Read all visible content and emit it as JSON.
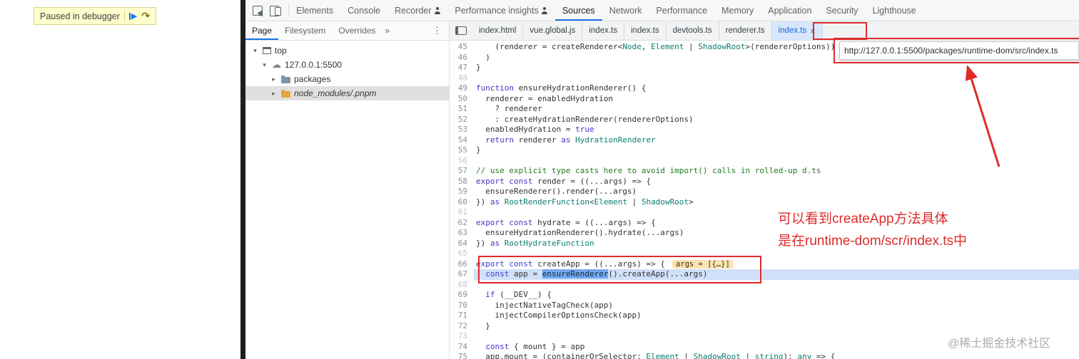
{
  "page": {
    "paused_banner": {
      "label": "Paused in debugger"
    }
  },
  "icon_glyphs": {
    "expanded": "▾",
    "collapsed": "▸",
    "cloud": "☁",
    "more": "⋮",
    "overflow": "»",
    "close": "×",
    "resume": "▶",
    "step_over": "↷"
  },
  "colors": {
    "accent": "#1a73e8",
    "annotation_red": "#e02b2b",
    "keyword": "#4135c4",
    "type": "#0b7f6e",
    "comment": "#237a23",
    "paused_line_bg": "#cfe0f8",
    "selection_bg": "#74a9ef",
    "inline_eval_bg": "#fbe3b3",
    "selected_row_bg": "#e0e0e0",
    "active_file_tab_bg": "#d7e7fe"
  },
  "devtools": {
    "toolbar": {
      "tabs": [
        {
          "label": "Elements"
        },
        {
          "label": "Console"
        },
        {
          "label": "Recorder",
          "badge": true
        },
        {
          "label": "Performance insights",
          "badge": true
        },
        {
          "label": "Sources",
          "active": true
        },
        {
          "label": "Network"
        },
        {
          "label": "Performance"
        },
        {
          "label": "Memory"
        },
        {
          "label": "Application"
        },
        {
          "label": "Security"
        },
        {
          "label": "Lighthouse"
        }
      ]
    },
    "sidebar": {
      "tabs": [
        {
          "label": "Page",
          "active": true
        },
        {
          "label": "Filesystem"
        },
        {
          "label": "Overrides"
        }
      ],
      "overflow_chevron": "»",
      "more_icon": "⋮",
      "tree": [
        {
          "label": "top",
          "icon": "frame",
          "depth": 0,
          "expanded": true
        },
        {
          "label": "127.0.0.1:5500",
          "icon": "cloud",
          "depth": 1,
          "expanded": true
        },
        {
          "label": "packages",
          "icon": "folder-blue",
          "depth": 2,
          "expanded": false
        },
        {
          "label": "node_modules/.pnpm",
          "icon": "folder-orange",
          "depth": 2,
          "expanded": false,
          "selected": true,
          "italic": true
        }
      ]
    },
    "editor": {
      "tabs": [
        {
          "label": "index.html"
        },
        {
          "label": "vue.global.js"
        },
        {
          "label": "index.ts"
        },
        {
          "label": "index.ts"
        },
        {
          "label": "devtools.ts"
        },
        {
          "label": "renderer.ts"
        },
        {
          "label": "index.ts",
          "active": true
        }
      ],
      "tab_tooltip_url": "http://127.0.0.1:5500/packages/runtime-dom/src/index.ts",
      "paused_line": 67,
      "lines": [
        {
          "n": 45,
          "tokens": [
            [
              "p",
              "    (renderer = createRenderer<"
            ],
            [
              "t",
              "Node"
            ],
            [
              "p",
              ", "
            ],
            [
              "t",
              "Element"
            ],
            [
              "p",
              " | "
            ],
            [
              "t",
              "ShadowRoot"
            ],
            [
              "p",
              ">(rendererOptions))"
            ]
          ]
        },
        {
          "n": 46,
          "tokens": [
            [
              "p",
              "  )"
            ]
          ]
        },
        {
          "n": 47,
          "tokens": [
            [
              "p",
              "}"
            ]
          ]
        },
        {
          "n": 48,
          "tokens": [],
          "dim": true
        },
        {
          "n": 49,
          "tokens": [
            [
              "k",
              "function"
            ],
            [
              "p",
              " ensureHydrationRenderer() {"
            ]
          ]
        },
        {
          "n": 50,
          "tokens": [
            [
              "p",
              "  renderer = enabledHydration"
            ]
          ]
        },
        {
          "n": 51,
          "tokens": [
            [
              "p",
              "    ? renderer"
            ]
          ]
        },
        {
          "n": 52,
          "tokens": [
            [
              "p",
              "    : createHydrationRenderer(rendererOptions)"
            ]
          ]
        },
        {
          "n": 53,
          "tokens": [
            [
              "p",
              "  enabledHydration = "
            ],
            [
              "k",
              "true"
            ]
          ]
        },
        {
          "n": 54,
          "tokens": [
            [
              "p",
              "  "
            ],
            [
              "k",
              "return"
            ],
            [
              "p",
              " renderer "
            ],
            [
              "k",
              "as"
            ],
            [
              "p",
              " "
            ],
            [
              "t",
              "HydrationRenderer"
            ]
          ]
        },
        {
          "n": 55,
          "tokens": [
            [
              "p",
              "}"
            ]
          ]
        },
        {
          "n": 56,
          "tokens": [],
          "dim": true
        },
        {
          "n": 57,
          "tokens": [
            [
              "c",
              "// use explicit type casts here to avoid import() calls in rolled-up d.ts"
            ]
          ]
        },
        {
          "n": 58,
          "tokens": [
            [
              "k",
              "export"
            ],
            [
              "p",
              " "
            ],
            [
              "k",
              "const"
            ],
            [
              "p",
              " render = ((...args) => {"
            ]
          ]
        },
        {
          "n": 59,
          "tokens": [
            [
              "p",
              "  ensureRenderer().render(...args)"
            ]
          ]
        },
        {
          "n": 60,
          "tokens": [
            [
              "p",
              "}) "
            ],
            [
              "k",
              "as"
            ],
            [
              "p",
              " "
            ],
            [
              "t",
              "RootRenderFunction"
            ],
            [
              "p",
              "<"
            ],
            [
              "t",
              "Element"
            ],
            [
              "p",
              " | "
            ],
            [
              "t",
              "ShadowRoot"
            ],
            [
              "p",
              ">"
            ]
          ]
        },
        {
          "n": 61,
          "tokens": [],
          "dim": true
        },
        {
          "n": 62,
          "tokens": [
            [
              "k",
              "export"
            ],
            [
              "p",
              " "
            ],
            [
              "k",
              "const"
            ],
            [
              "p",
              " hydrate = ((...args) => {"
            ]
          ]
        },
        {
          "n": 63,
          "tokens": [
            [
              "p",
              "  ensureHydrationRenderer().hydrate(...args)"
            ]
          ]
        },
        {
          "n": 64,
          "tokens": [
            [
              "p",
              "}) "
            ],
            [
              "k",
              "as"
            ],
            [
              "p",
              " "
            ],
            [
              "t",
              "RootHydrateFunction"
            ]
          ]
        },
        {
          "n": 65,
          "tokens": [],
          "dim": true
        },
        {
          "n": 66,
          "tokens": [
            [
              "k",
              "export"
            ],
            [
              "p",
              " "
            ],
            [
              "k",
              "const"
            ],
            [
              "p",
              " createApp = ((...args) => {"
            ]
          ],
          "badge": "args = [{…}]"
        },
        {
          "n": 67,
          "tokens": [
            [
              "p",
              "  "
            ],
            [
              "k",
              "const"
            ],
            [
              "p",
              " app = "
            ],
            [
              "s",
              "ensureRenderer"
            ],
            [
              "p",
              "().createApp(...args)"
            ]
          ],
          "paused": true
        },
        {
          "n": 68,
          "tokens": [],
          "dim": true
        },
        {
          "n": 69,
          "tokens": [
            [
              "p",
              "  "
            ],
            [
              "k",
              "if"
            ],
            [
              "p",
              " (__DEV__) {"
            ]
          ]
        },
        {
          "n": 70,
          "tokens": [
            [
              "p",
              "    injectNativeTagCheck(app)"
            ]
          ]
        },
        {
          "n": 71,
          "tokens": [
            [
              "p",
              "    injectCompilerOptionsCheck(app)"
            ]
          ]
        },
        {
          "n": 72,
          "tokens": [
            [
              "p",
              "  }"
            ]
          ]
        },
        {
          "n": 73,
          "tokens": [],
          "dim": true
        },
        {
          "n": 74,
          "tokens": [
            [
              "p",
              "  "
            ],
            [
              "k",
              "const"
            ],
            [
              "p",
              " { mount } = app"
            ]
          ]
        },
        {
          "n": 75,
          "tokens": [
            [
              "p",
              "  app.mount = (containerOrSelector: "
            ],
            [
              "t",
              "Element"
            ],
            [
              "p",
              " | "
            ],
            [
              "t",
              "ShadowRoot"
            ],
            [
              "p",
              " | "
            ],
            [
              "t",
              "string"
            ],
            [
              "p",
              "): "
            ],
            [
              "t",
              "any"
            ],
            [
              "p",
              " => {"
            ]
          ]
        }
      ]
    }
  },
  "annotations": {
    "note_line1": "可以看到createApp方法具体",
    "note_line2": "是在runtime-dom/scr/index.ts中",
    "watermark": "@稀土掘金技术社区"
  }
}
